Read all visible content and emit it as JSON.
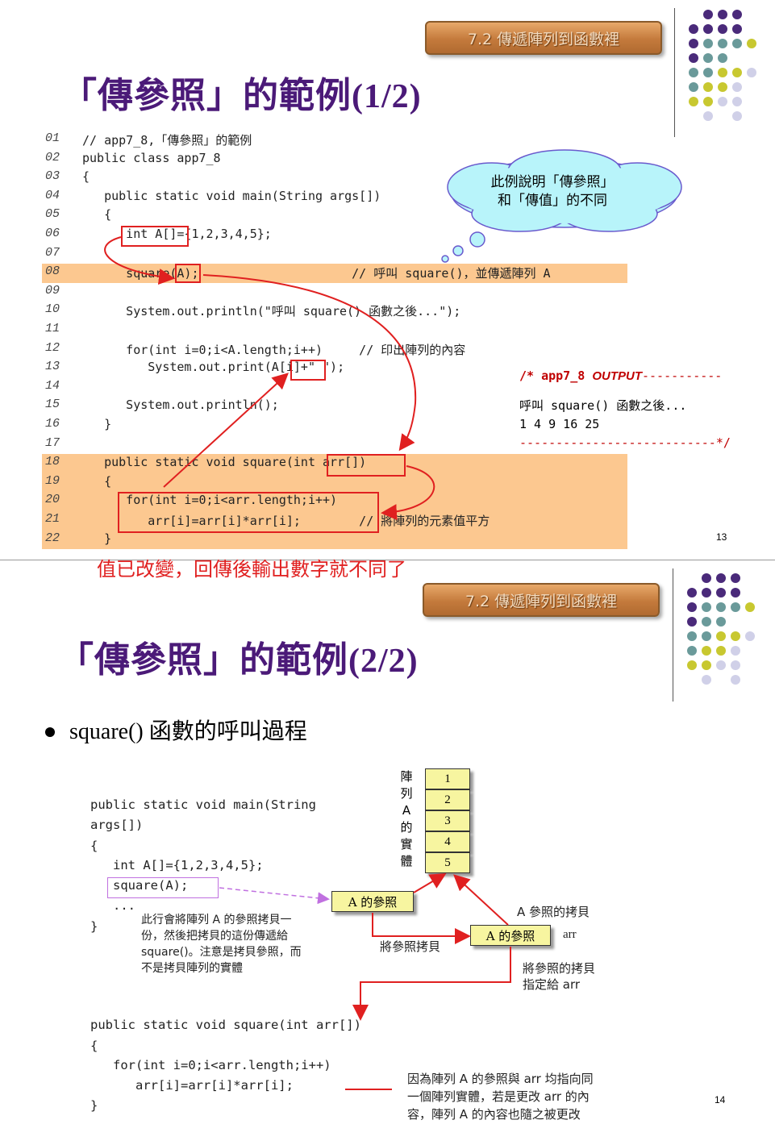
{
  "slide1": {
    "badge": "7.2 傳遞陣列到函數裡",
    "title_cn": "「傳參照」的範例",
    "title_num": "(1/2)",
    "lines": [
      {
        "no": "01",
        "code": "// app7_8,「傳參照」的範例"
      },
      {
        "no": "02",
        "code": "public class app7_8"
      },
      {
        "no": "03",
        "code": "{"
      },
      {
        "no": "04",
        "code": "   public static void main(String args[])"
      },
      {
        "no": "05",
        "code": "   {"
      },
      {
        "no": "06",
        "code": "      int A[]={1,2,3,4,5};"
      },
      {
        "no": "07",
        "code": ""
      },
      {
        "no": "08",
        "code": "      square(A);                     // 呼叫 square()，並傳遞陣列 A"
      },
      {
        "no": "09",
        "code": ""
      },
      {
        "no": "10",
        "code": "      System.out.println(\"呼叫 square() 函數之後...\");"
      },
      {
        "no": "11",
        "code": ""
      },
      {
        "no": "12",
        "code": "      for(int i=0;i<A.length;i++)     // 印出陣列的內容"
      },
      {
        "no": "13",
        "code": "         System.out.print(A[i]+\" \");"
      },
      {
        "no": "14",
        "code": ""
      },
      {
        "no": "15",
        "code": "      System.out.println();"
      },
      {
        "no": "16",
        "code": "   }"
      },
      {
        "no": "17",
        "code": ""
      },
      {
        "no": "18",
        "code": "   public static void square(int arr[])"
      },
      {
        "no": "19",
        "code": "   {"
      },
      {
        "no": "20",
        "code": "      for(int i=0;i<arr.length;i++)"
      },
      {
        "no": "21",
        "code": "         arr[i]=arr[i]*arr[i];        // 將陣列的元素值平方"
      },
      {
        "no": "22",
        "code": "   }"
      }
    ],
    "cloud": [
      "此例說明「傳參照」",
      "和「傳值」的不同"
    ],
    "output": {
      "header_a": "/* app7_8 ",
      "header_b": "OUTPUT",
      "header_c": "-----------",
      "line1": "呼叫 square() 函數之後...",
      "line2": "1 4 9 16 25",
      "footer": "---------------------------*/"
    },
    "caption": "值已改變，回傳後輸出數字就不同了",
    "page": "13"
  },
  "slide2": {
    "badge": "7.2 傳遞陣列到函數裡",
    "title_cn": "「傳參照」的範例",
    "title_num": "(2/2)",
    "bullet": "square() 函數的呼叫過程",
    "main_code": [
      "public static void main(String",
      "args[])",
      "{",
      "   int A[]={1,2,3,4,5};",
      "   square(A);",
      "   ...",
      "}"
    ],
    "note1": [
      "此行會將陣列 A 的參照拷貝一",
      "份，然後把拷貝的這份傳遞給",
      "square()。注意是拷貝參照，而",
      "不是拷貝陣列的實體"
    ],
    "array_label": [
      "陣",
      "列",
      "A",
      "的",
      "實",
      "體"
    ],
    "array_cells": [
      "1",
      "2",
      "3",
      "4",
      "5"
    ],
    "ref_box1": "A 的參照",
    "ref_box2": "A 的參照",
    "copy_label": "A 參照的拷貝",
    "arr_label": "arr",
    "copy_ref": "將參照拷貝",
    "assign": [
      "將參照的拷貝",
      "指定給 arr"
    ],
    "square_code": [
      "public static void square(int arr[])",
      "{",
      "   for(int i=0;i<arr.length;i++)",
      "      arr[i]=arr[i]*arr[i];",
      "}"
    ],
    "note2": [
      "因為陣列 A 的參照與 arr 均指向同",
      "一個陣列實體，若是更改 arr 的內",
      "容，陣列 A 的內容也隨之被更改"
    ],
    "page": "14"
  },
  "colors": {
    "title": "#4b1a78",
    "accent_red": "#e02020",
    "highlight": "#fcc890",
    "dot_purple": "#4a2a7a",
    "dot_teal": "#6a9a9a",
    "dot_yellow": "#c8c830",
    "dot_lavender": "#d0d0e8"
  }
}
